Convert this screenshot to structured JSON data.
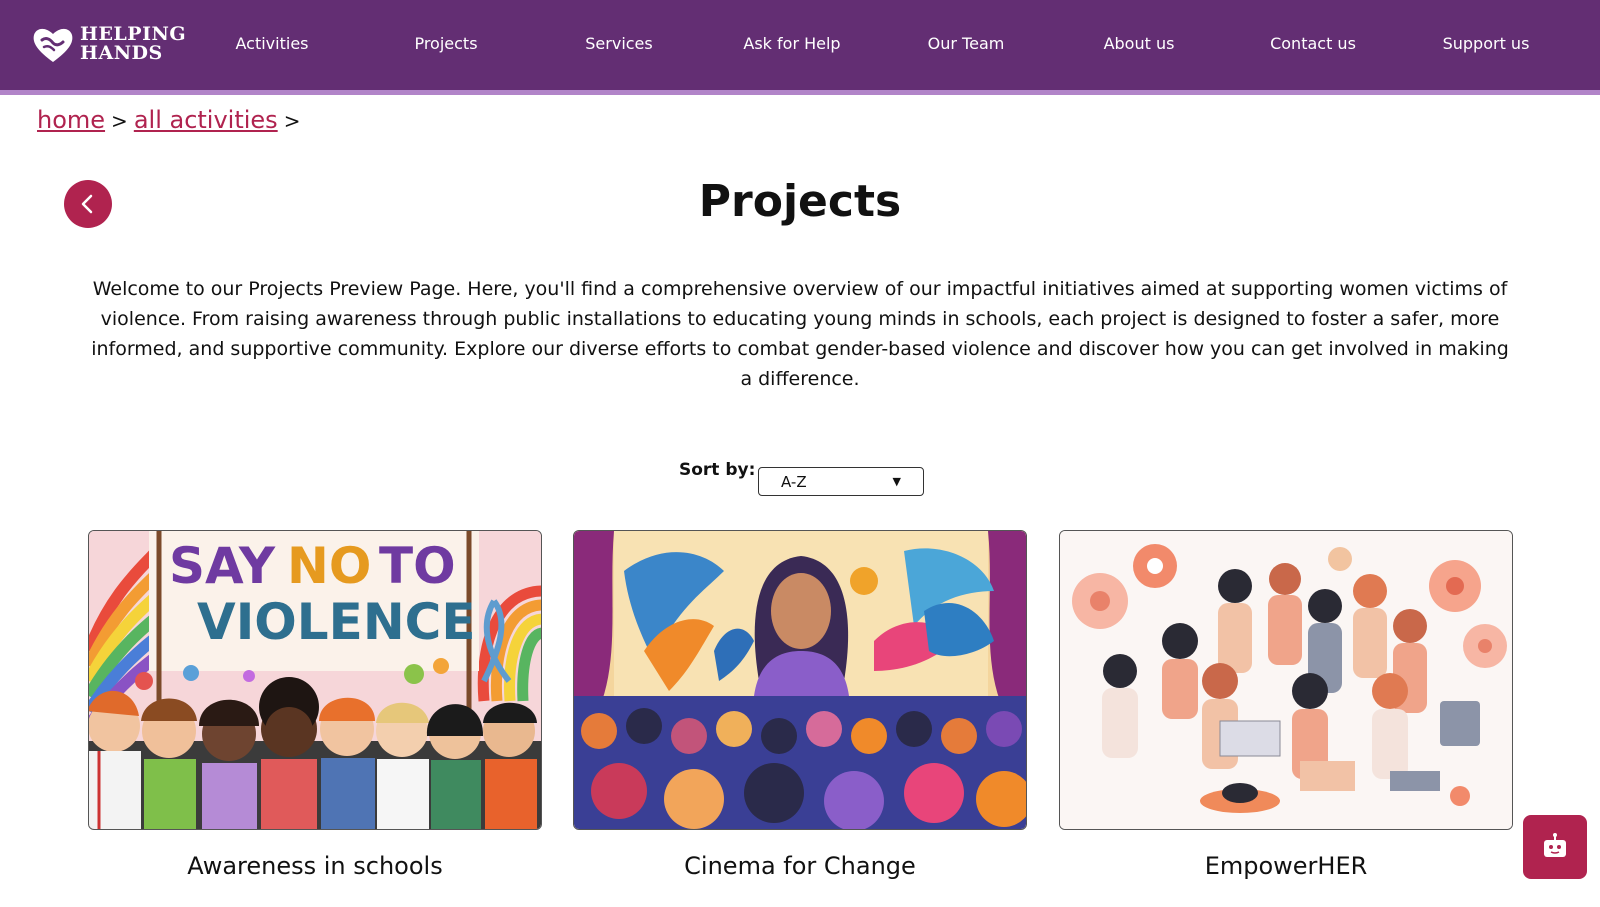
{
  "brand": {
    "line1": "HELPING",
    "line2": "HANDS"
  },
  "nav": [
    {
      "label": "Activities"
    },
    {
      "label": "Projects"
    },
    {
      "label": "Services"
    },
    {
      "label": "Ask for Help"
    },
    {
      "label": "Our Team"
    },
    {
      "label": "About us"
    },
    {
      "label": "Contact us"
    },
    {
      "label": "Support us"
    }
  ],
  "breadcrumb": {
    "home": "home",
    "all": "all activities",
    "sep": ">"
  },
  "page": {
    "title": "Projects",
    "intro": "Welcome to our Projects Preview Page. Here, you'll find a comprehensive overview of our impactful initiatives aimed at supporting women victims of violence. From raising awareness through public installations to educating young minds in schools, each project is designed to foster a safer, more informed, and supportive community. Explore our diverse efforts to combat gender-based violence and discover how you can get involved in making a difference."
  },
  "sort": {
    "label": "Sort by:",
    "selected": "A-Z"
  },
  "cards": [
    {
      "title": "Awareness in schools",
      "banner_line1": "SAY",
      "banner_word2": "NO",
      "banner_word3": "TO",
      "banner_line2": "VIOLENCE"
    },
    {
      "title": "Cinema for Change"
    },
    {
      "title": "EmpowerHER"
    }
  ],
  "colors": {
    "header": "#632e73",
    "accent": "#b0234f",
    "header_stripe": "#b184c8"
  },
  "icons": {
    "back": "chevron-left-icon",
    "chat": "chatbot-icon",
    "logo": "heart-hands-icon"
  }
}
